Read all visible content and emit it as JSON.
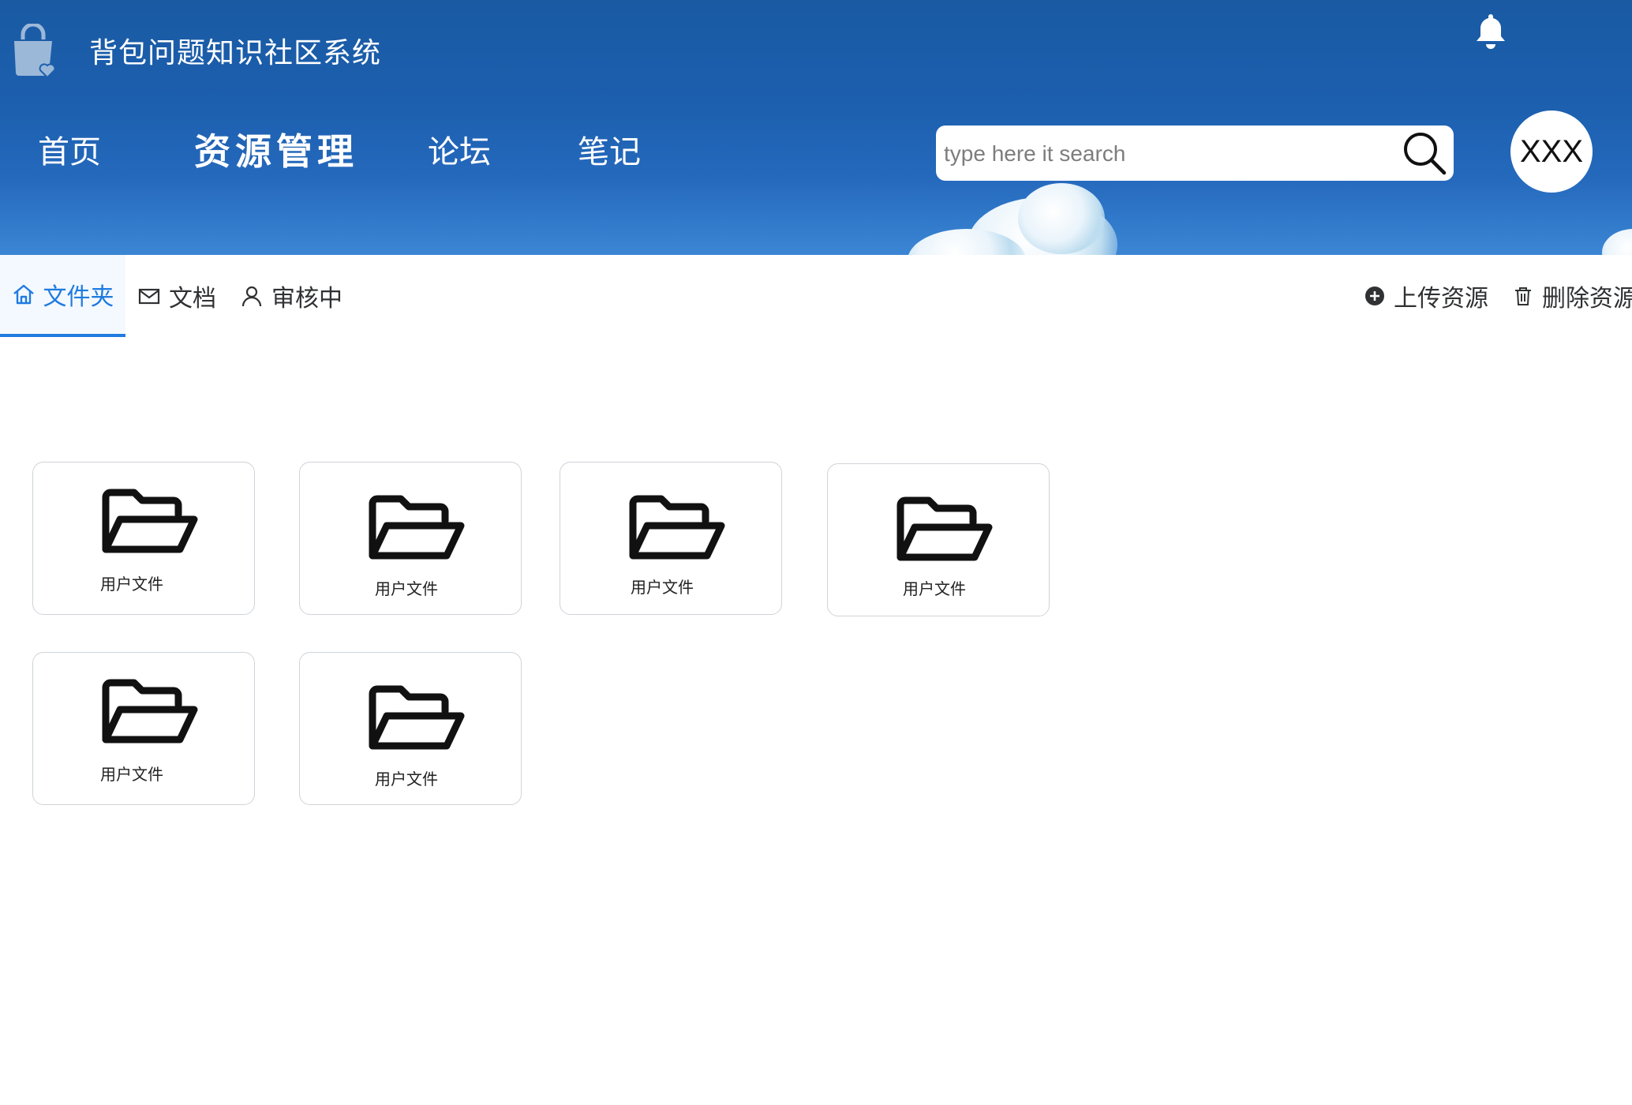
{
  "header": {
    "logo_icon": "shopping-bag-heart-icon",
    "site_title": "背包问题知识社区系统",
    "bell_icon": "bell-icon",
    "nav": [
      {
        "label": "首页",
        "active": false
      },
      {
        "label": "资源管理",
        "active": true
      },
      {
        "label": "论坛",
        "active": false
      },
      {
        "label": "笔记",
        "active": false
      }
    ],
    "search": {
      "placeholder": "type here it search",
      "value": "",
      "icon": "search-icon"
    },
    "avatar_text": "XXX"
  },
  "tabs": {
    "items": [
      {
        "label": "文件夹",
        "icon": "home-icon",
        "active": true
      },
      {
        "label": "文档",
        "icon": "mail-icon",
        "active": false
      },
      {
        "label": "审核中",
        "icon": "user-icon",
        "active": false
      }
    ],
    "actions": [
      {
        "label": "上传资源",
        "icon": "plus-circle-icon"
      },
      {
        "label": "删除资源",
        "icon": "trash-icon"
      }
    ]
  },
  "folders": [
    {
      "label": "用户文件",
      "icon": "folder-open-icon"
    },
    {
      "label": "用户文件",
      "icon": "folder-open-icon"
    },
    {
      "label": "用户文件",
      "icon": "folder-open-icon"
    },
    {
      "label": "用户文件",
      "icon": "folder-open-icon"
    },
    {
      "label": "用户文件",
      "icon": "folder-open-icon"
    },
    {
      "label": "用户文件",
      "icon": "folder-open-icon"
    }
  ],
  "colors": {
    "header_blue": "#1c5fae",
    "accent": "#1f7be0",
    "card_border": "#cfd3d8"
  }
}
